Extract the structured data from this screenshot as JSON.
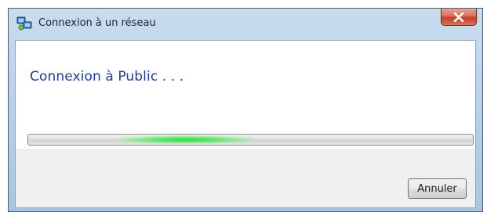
{
  "window": {
    "title": "Connexion à un réseau",
    "icon": "network-icon"
  },
  "titlebar": {
    "close_icon": "close-icon"
  },
  "main": {
    "status_text": "Connexion à Public . . ."
  },
  "progress": {
    "mode": "indeterminate",
    "glow_color": "#28dc3c",
    "glow_position_fraction": 0.2
  },
  "footer": {
    "cancel_label": "Annuler"
  },
  "colors": {
    "heading": "#1f3f8f",
    "close_button": "#c0412b",
    "frame": "#bcd2ea"
  }
}
